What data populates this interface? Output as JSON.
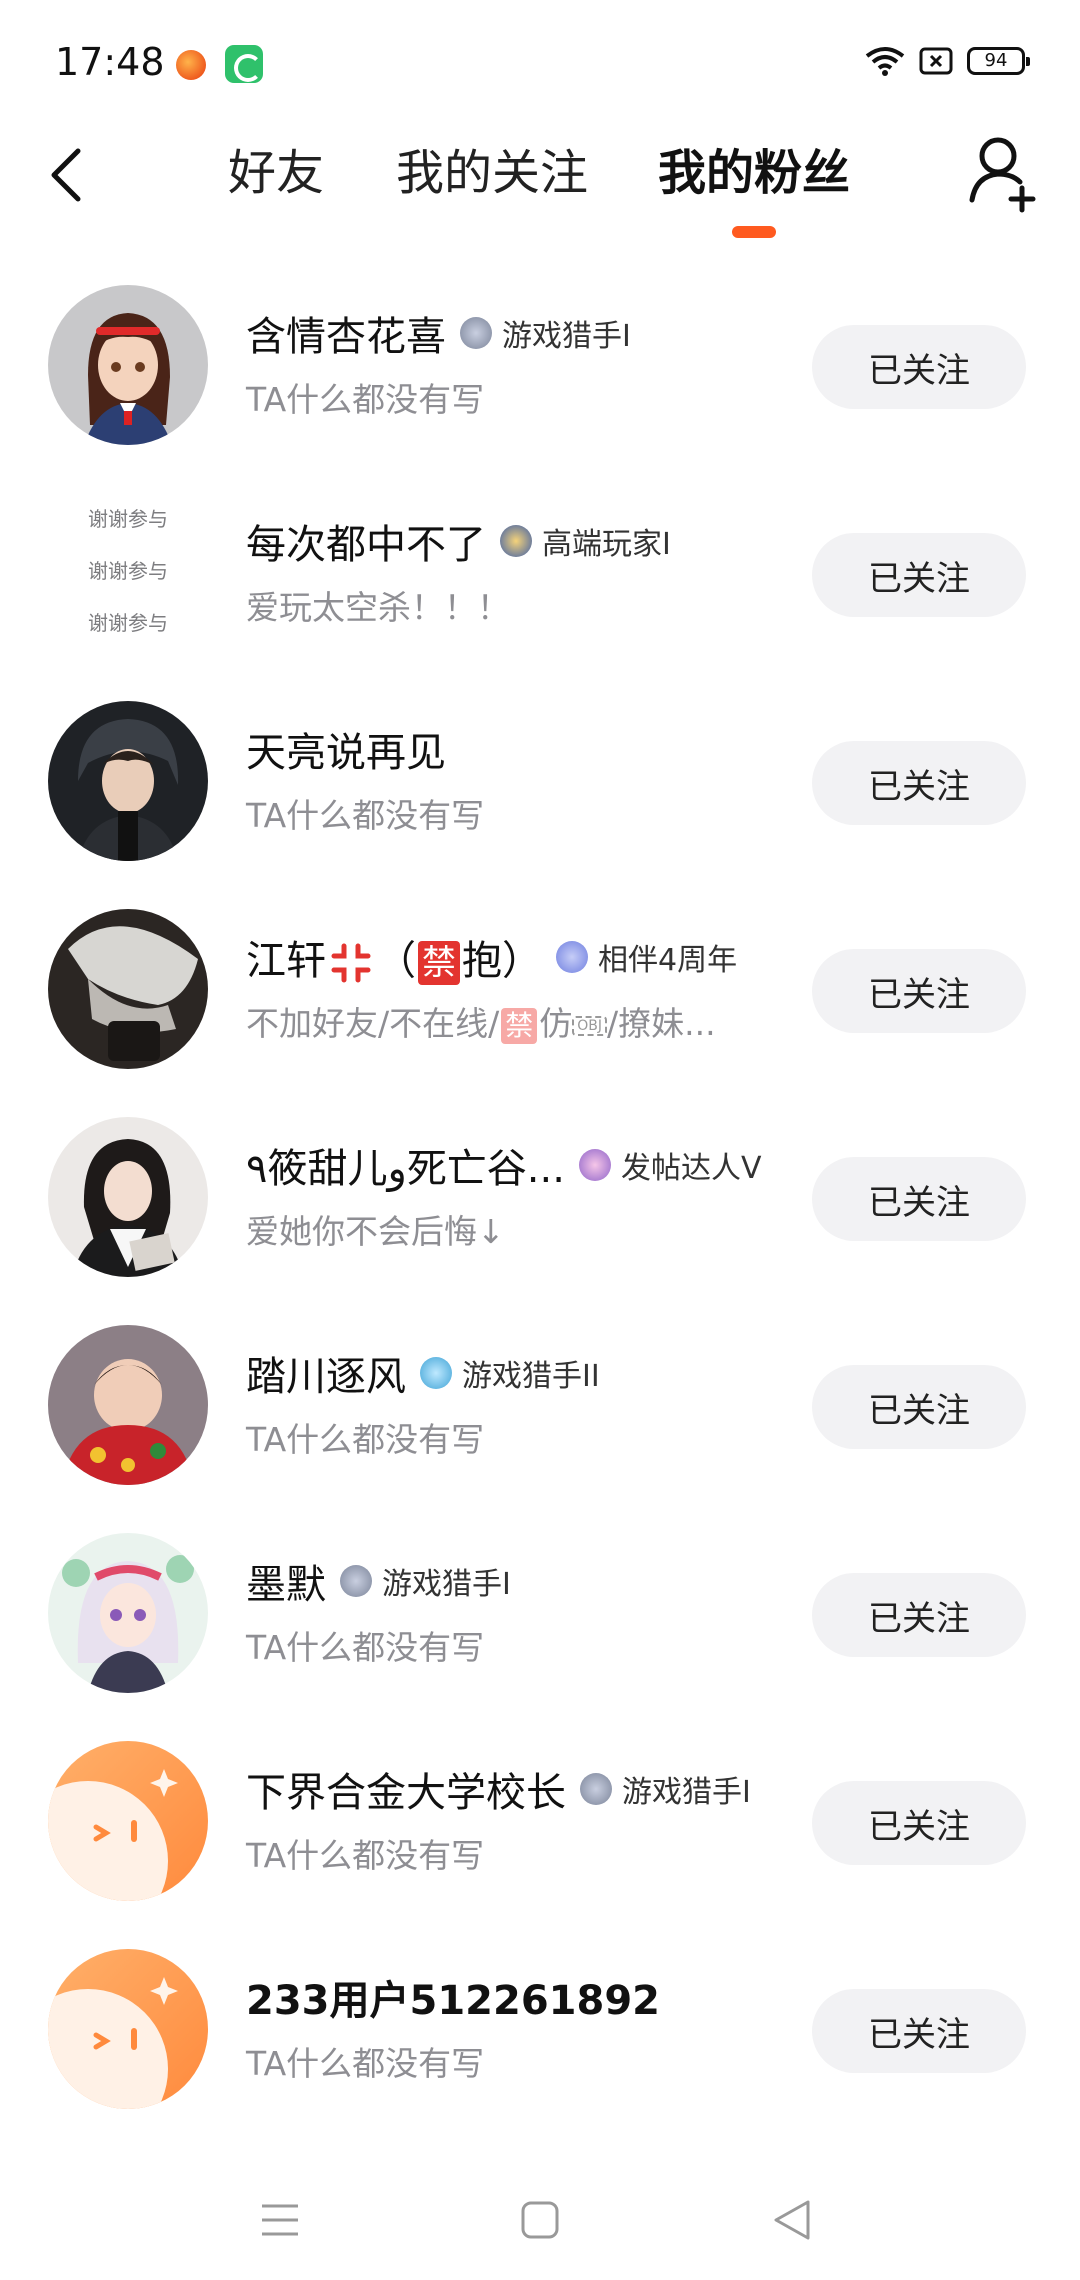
{
  "status_bar": {
    "time": "17:48",
    "battery": "94",
    "icons": [
      "app-notification-icon",
      "app-notification-icon",
      "wifi-icon",
      "sim-off-icon",
      "battery-icon"
    ]
  },
  "nav": {
    "tabs": [
      {
        "label": "好友",
        "active": false
      },
      {
        "label": "我的关注",
        "active": false
      },
      {
        "label": "我的粉丝",
        "active": true
      }
    ],
    "accent_color": "#ff5a1f"
  },
  "followers": [
    {
      "name": "含情杏花喜",
      "badge": "游戏猎手I",
      "bio": "TA什么都没有写",
      "button": "已关注"
    },
    {
      "name": "每次都中不了",
      "badge": "高端玩家I",
      "bio": "爱玩太空杀！！！",
      "button": "已关注",
      "avatar_text": [
        "谢谢参与",
        "谢谢参与",
        "谢谢参与"
      ]
    },
    {
      "name": "天亮说再见",
      "badge": "",
      "bio": "TA什么都没有写",
      "button": "已关注"
    },
    {
      "name_pre": "江轩",
      "name_paren_open": "（",
      "name_forbid": "禁",
      "name_post": "抱）",
      "badge": "相伴4周年",
      "bio_pre": "不加好友/不在线/",
      "bio_forbid": "禁",
      "bio_mid": "仿",
      "bio_obj": "OBJ",
      "bio_post": "/撩妹...",
      "button": "已关注"
    },
    {
      "name": "٩筱甜儿و死亡谷...",
      "badge": "发帖达人V",
      "bio": "爱她你不会后悔↓",
      "button": "已关注"
    },
    {
      "name": "踏川逐风",
      "badge": "游戏猎手II",
      "bio": "TA什么都没有写",
      "button": "已关注"
    },
    {
      "name": "墨默",
      "badge": "游戏猎手I",
      "bio": "TA什么都没有写",
      "button": "已关注"
    },
    {
      "name": "下界合金大学校长",
      "badge": "游戏猎手I",
      "bio": "TA什么都没有写",
      "button": "已关注"
    },
    {
      "name": "233用户512261892",
      "badge": "",
      "bio": "TA什么都没有写",
      "button": "已关注"
    }
  ]
}
